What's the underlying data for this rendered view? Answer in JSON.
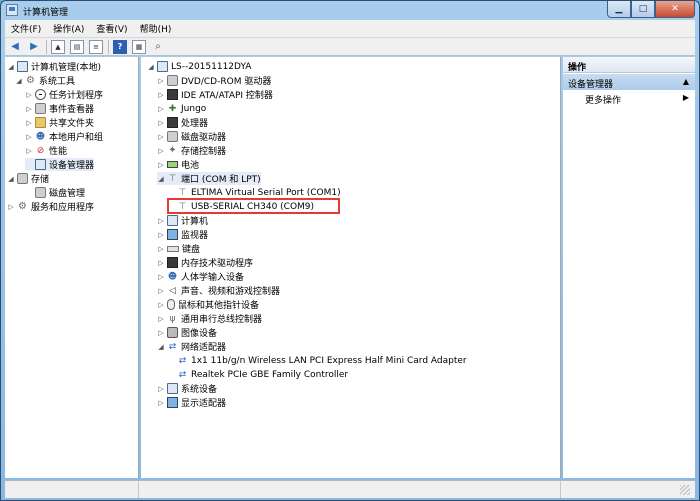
{
  "window": {
    "title": "计算机管理"
  },
  "menu": [
    "文件(F)",
    "操作(A)",
    "查看(V)",
    "帮助(H)"
  ],
  "toolbar_icons": [
    "back-arrow-icon",
    "forward-arrow-icon",
    "up-folder-icon",
    "show-tree-icon",
    "properties-icon",
    "help-icon",
    "console-icon",
    "scan-hardware-icon"
  ],
  "left_tree": {
    "root": "计算机管理(本地)",
    "system_tools": "系统工具",
    "task_scheduler": "任务计划程序",
    "event_viewer": "事件查看器",
    "shared_folders": "共享文件夹",
    "local_users": "本地用户和组",
    "performance": "性能",
    "device_manager": "设备管理器",
    "storage": "存储",
    "disk_management": "磁盘管理",
    "services": "服务和应用程序"
  },
  "device_tree": {
    "computer": "LS--20151112DYA",
    "items": [
      "DVD/CD-ROM 驱动器",
      "IDE ATA/ATAPI 控制器",
      "Jungo",
      "处理器",
      "磁盘驱动器",
      "存储控制器",
      "电池",
      "端口 (COM 和 LPT)",
      "ELTIMA Virtual Serial Port (COM1)",
      "USB-SERIAL CH340 (COM9)",
      "计算机",
      "监视器",
      "键盘",
      "内存技术驱动程序",
      "人体学输入设备",
      "声音、视频和游戏控制器",
      "鼠标和其他指针设备",
      "通用串行总线控制器",
      "图像设备",
      "网络适配器",
      "1x1 11b/g/n Wireless LAN PCI Express Half Mini Card Adapter",
      "Realtek PCIe GBE Family Controller",
      "系统设备",
      "显示适配器"
    ]
  },
  "actions": {
    "header": "操作",
    "section": "设备管理器",
    "more": "更多操作"
  },
  "colors": {
    "highlight_box": "#e53935",
    "window_frame": "#8bb8e0"
  }
}
